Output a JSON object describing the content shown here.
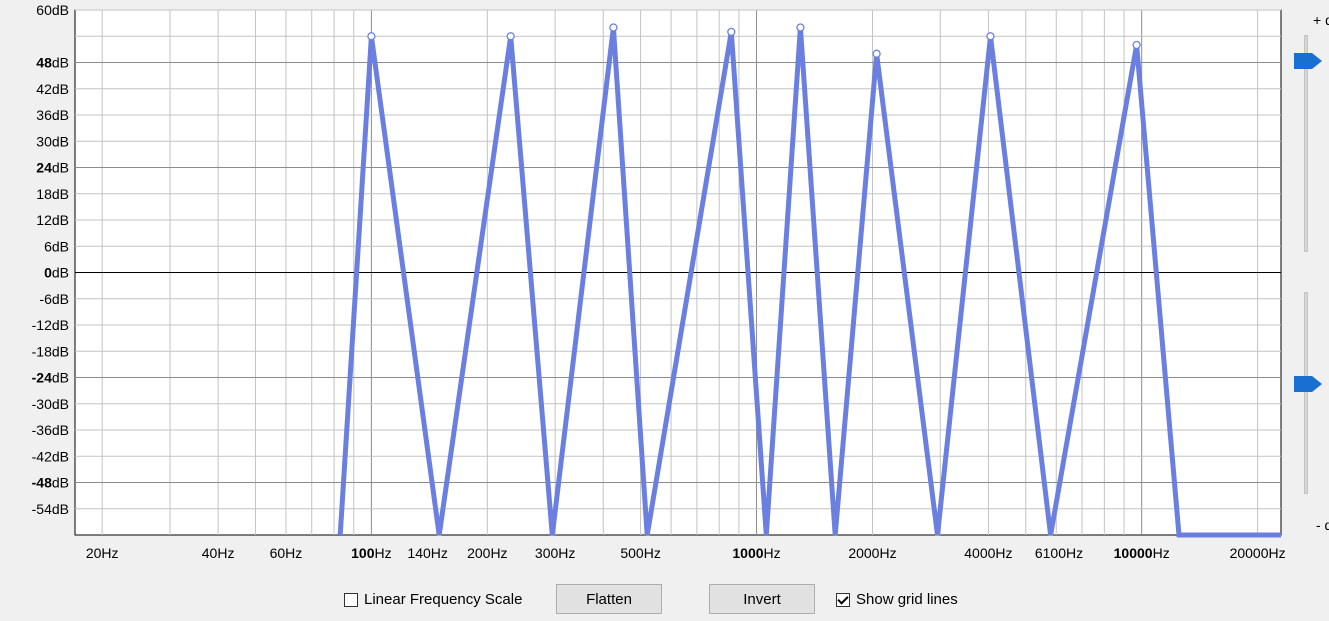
{
  "y_axis": {
    "labels": [
      {
        "db": 60,
        "text": "60dB",
        "bold": false
      },
      {
        "db": 48,
        "text": "48dB",
        "bold": true
      },
      {
        "db": 42,
        "text": "42dB",
        "bold": false
      },
      {
        "db": 36,
        "text": "36dB",
        "bold": false
      },
      {
        "db": 30,
        "text": "30dB",
        "bold": false
      },
      {
        "db": 24,
        "text": "24dB",
        "bold": true
      },
      {
        "db": 18,
        "text": "18dB",
        "bold": false
      },
      {
        "db": 12,
        "text": "12dB",
        "bold": false
      },
      {
        "db": 6,
        "text": "6dB",
        "bold": false
      },
      {
        "db": 0,
        "text": "0dB",
        "bold": true
      },
      {
        "db": -6,
        "text": "-6dB",
        "bold": false
      },
      {
        "db": -12,
        "text": "-12dB",
        "bold": false
      },
      {
        "db": -18,
        "text": "-18dB",
        "bold": false
      },
      {
        "db": -24,
        "text": "-24dB",
        "bold": true
      },
      {
        "db": -30,
        "text": "-30dB",
        "bold": false
      },
      {
        "db": -36,
        "text": "-36dB",
        "bold": false
      },
      {
        "db": -42,
        "text": "-42dB",
        "bold": false
      },
      {
        "db": -48,
        "text": "-48dB",
        "bold": true
      },
      {
        "db": -54,
        "text": "-54dB",
        "bold": false
      }
    ],
    "range": [
      -60,
      60
    ]
  },
  "x_axis": {
    "scale": "log",
    "range": [
      17,
      23000
    ],
    "labels": [
      {
        "hz": 20,
        "num": "20",
        "unit": "Hz",
        "bold": false,
        "small": false
      },
      {
        "hz": 40,
        "num": "40",
        "unit": "Hz",
        "bold": false,
        "small": false
      },
      {
        "hz": 60,
        "num": "60",
        "unit": "Hz",
        "bold": false,
        "small": false
      },
      {
        "hz": 100,
        "num": "100",
        "unit": "Hz",
        "bold": true,
        "small": false
      },
      {
        "hz": 140,
        "num": "140",
        "unit": "Hz",
        "bold": false,
        "small": true
      },
      {
        "hz": 200,
        "num": "200",
        "unit": "Hz",
        "bold": false,
        "small": false
      },
      {
        "hz": 300,
        "num": "300",
        "unit": "Hz",
        "bold": false,
        "small": false
      },
      {
        "hz": 500,
        "num": "500",
        "unit": "Hz",
        "bold": false,
        "small": false
      },
      {
        "hz": 1000,
        "num": "1000",
        "unit": "Hz",
        "bold": true,
        "small": false
      },
      {
        "hz": 2000,
        "num": "2000",
        "unit": "Hz",
        "bold": false,
        "small": false
      },
      {
        "hz": 4000,
        "num": "4000",
        "unit": "Hz",
        "bold": false,
        "small": false
      },
      {
        "hz": 6100,
        "num": "6100",
        "unit": "Hz",
        "bold": false,
        "small": true
      },
      {
        "hz": 10000,
        "num": "10000",
        "unit": "Hz",
        "bold": true,
        "small": false
      },
      {
        "hz": 20000,
        "num": "20000",
        "unit": "Hz",
        "bold": false,
        "small": false
      }
    ]
  },
  "gain_slider": {
    "top_label": "+ dB",
    "bottom_label": "- dB",
    "max_db": 48,
    "min_db": -24
  },
  "chart_data": {
    "type": "line",
    "xscale": "log",
    "ylim": [
      -60,
      60
    ],
    "grid": true,
    "colors": {
      "curve": "#6a7fe0",
      "response": "#19e019",
      "grid": "#b4b4b4",
      "zero": "#000000"
    },
    "control_points": [
      {
        "hz": 100,
        "db": 54
      },
      {
        "hz": 230,
        "db": 54
      },
      {
        "hz": 425,
        "db": 56
      },
      {
        "hz": 860,
        "db": 55
      },
      {
        "hz": 1300,
        "db": 56
      },
      {
        "hz": 2050,
        "db": 50
      },
      {
        "hz": 4050,
        "db": 54
      },
      {
        "hz": 9700,
        "db": 52
      }
    ],
    "curve": [
      {
        "hz": 83,
        "db": -60
      },
      {
        "hz": 100,
        "db": 54
      },
      {
        "hz": 150,
        "db": -60
      },
      {
        "hz": 230,
        "db": 54
      },
      {
        "hz": 295,
        "db": -60
      },
      {
        "hz": 425,
        "db": 56
      },
      {
        "hz": 520,
        "db": -60
      },
      {
        "hz": 860,
        "db": 55
      },
      {
        "hz": 1060,
        "db": -60
      },
      {
        "hz": 1300,
        "db": 56
      },
      {
        "hz": 1600,
        "db": -60
      },
      {
        "hz": 2050,
        "db": 50
      },
      {
        "hz": 2950,
        "db": -60
      },
      {
        "hz": 4050,
        "db": 54
      },
      {
        "hz": 5800,
        "db": -60
      },
      {
        "hz": 9700,
        "db": 52
      },
      {
        "hz": 12500,
        "db": -60
      },
      {
        "hz": 23000,
        "db": -60
      }
    ]
  },
  "controls": {
    "linear_scale_label": "Linear Frequency Scale",
    "linear_scale_checked": false,
    "flatten_label": "Flatten",
    "invert_label": "Invert",
    "grid_lines_label": "Show grid lines",
    "grid_lines_checked": true
  }
}
